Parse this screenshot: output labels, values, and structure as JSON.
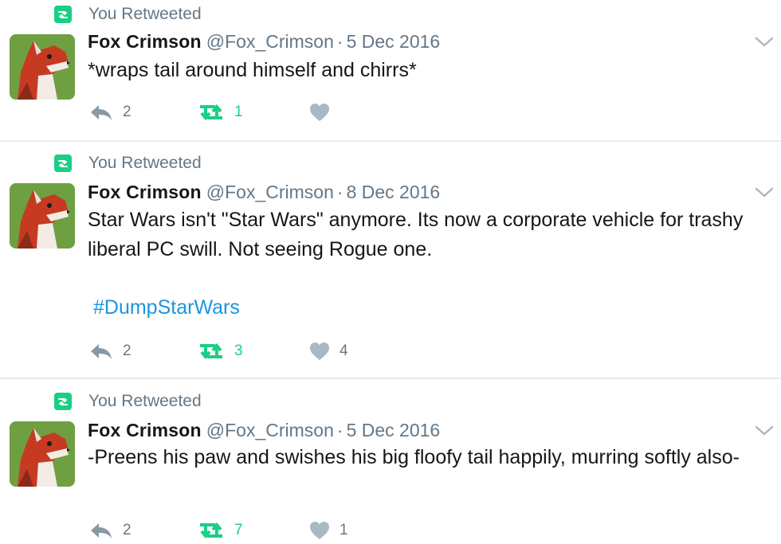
{
  "colors": {
    "retweet_green": "#19cf86",
    "link_blue": "#1b95e0",
    "muted": "#657786",
    "text": "#14171a"
  },
  "icons": {
    "retweeted": "retweet-badge-icon",
    "reply": "reply-icon",
    "retweet": "retweet-icon",
    "like": "heart-icon",
    "menu": "chevron-down-icon"
  },
  "tweets": [
    {
      "retweet_label": "You Retweeted",
      "name": "Fox Crimson",
      "handle": "@Fox_Crimson",
      "separator": "·",
      "date": "5 Dec 2016",
      "text": "*wraps tail around himself and chirrs*",
      "hashtag": "",
      "replies": "2",
      "retweets": "1",
      "likes": ""
    },
    {
      "retweet_label": "You Retweeted",
      "name": "Fox Crimson",
      "handle": "@Fox_Crimson",
      "separator": "·",
      "date": "8 Dec 2016",
      "text": "Star Wars isn't \"Star Wars\" anymore. Its now a corporate vehicle for trashy liberal PC swill. Not seeing Rogue one.",
      "hashtag": "#DumpStarWars",
      "replies": "2",
      "retweets": "3",
      "likes": "4"
    },
    {
      "retweet_label": "You Retweeted",
      "name": "Fox Crimson",
      "handle": "@Fox_Crimson",
      "separator": "·",
      "date": "5 Dec 2016",
      "text": "-Preens his paw and swishes his big floofy tail happily, murring softly also-",
      "hashtag": "",
      "replies": "2",
      "retweets": "7",
      "likes": "1"
    }
  ]
}
